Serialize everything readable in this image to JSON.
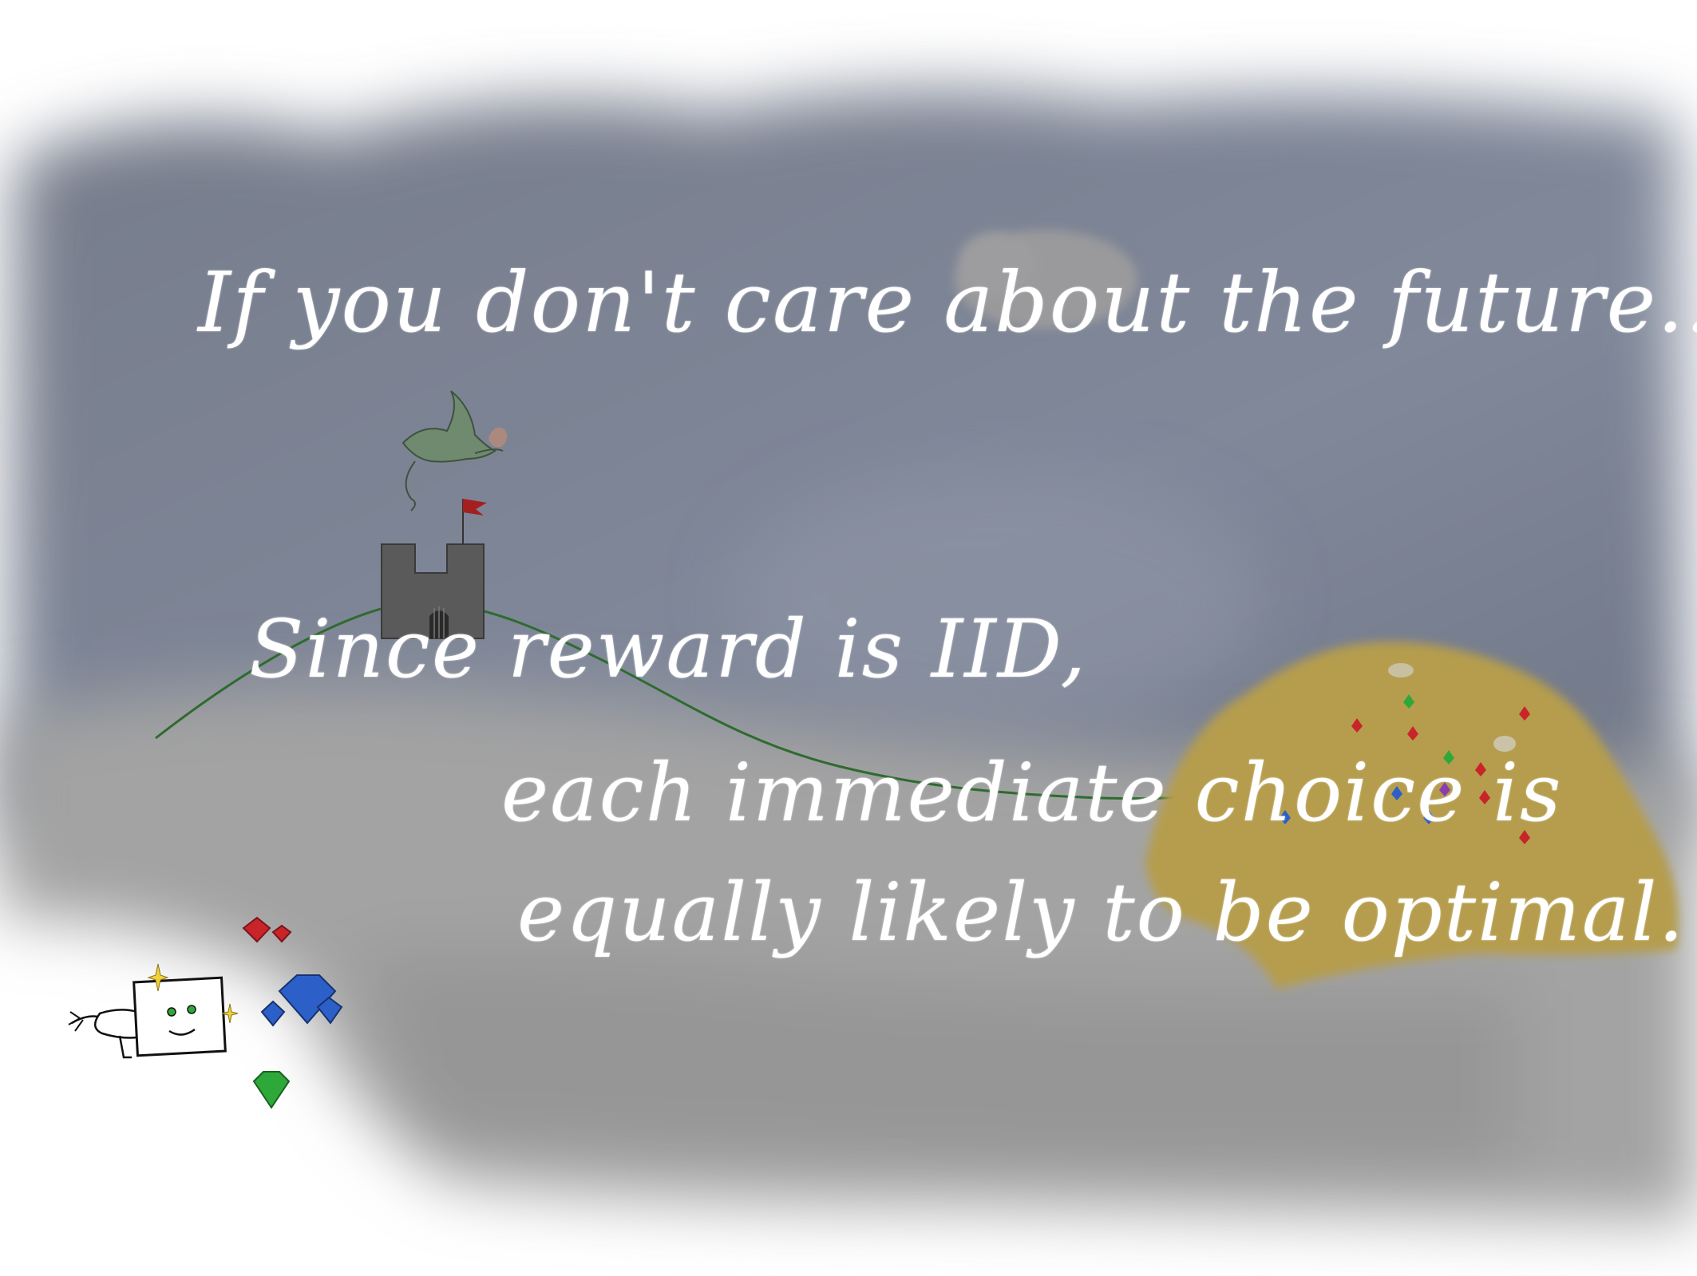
{
  "captions": {
    "line1": "If you don't care about the future...",
    "line2": "Since reward is IID,",
    "line3": "each immediate choice is",
    "line4": "equally likely to be optimal."
  },
  "colors": {
    "sky": "#7b8190",
    "fog": "#a4a4a4",
    "gold": "#b8a04c",
    "hill_line": "#2e6b2e",
    "castle": "#5a5a5a",
    "flag": "#a51f1f",
    "dragon": "#6f8a6f",
    "gem_red": "#c8242a",
    "gem_blue": "#2d5fc8",
    "gem_green": "#2fa83a",
    "sparkle": "#f0d23a"
  },
  "illustration": {
    "elements": [
      "cloud",
      "dragon",
      "castle",
      "flag",
      "hill",
      "treasure-pile",
      "robot-character",
      "gems"
    ]
  }
}
